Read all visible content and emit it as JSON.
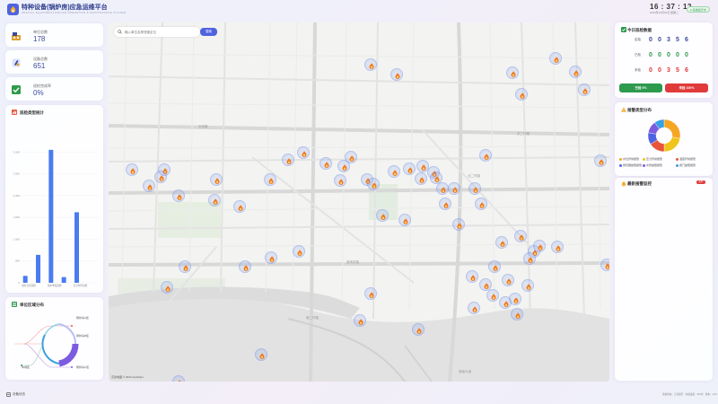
{
  "header": {
    "title": "特种设备(锅炉房)应急运维平台",
    "subtitle": "SPECIAL EQUIPMENT BOILER OPERATION & MAINTENANCE SYSTEM",
    "time": "16 : 37 : 12",
    "date": "2024年12月03日 星期二",
    "status": "● 系统运行中"
  },
  "stats": [
    {
      "label": "单位总数",
      "value": "178",
      "icon": "building-icon"
    },
    {
      "label": "设备总数",
      "value": "651",
      "icon": "equipment-icon"
    },
    {
      "label": "巡检完成率",
      "value": "0%",
      "icon": "check-icon"
    }
  ],
  "inspection_panel": {
    "title": "巡检类型统计"
  },
  "chart_data": {
    "type": "bar",
    "title": "",
    "categories": [
      "",
      "",
      "",
      "",
      "",
      ""
    ],
    "values": [
      160,
      640,
      3050,
      130,
      1620,
      0
    ],
    "ylim": [
      0,
      3500
    ],
    "yticks": [
      "0",
      "500",
      "1,000",
      "1,500",
      "2,000",
      "2,500",
      "3,000"
    ],
    "xticklabels": [
      "锅炉日常巡检",
      "",
      "锅炉季度巡检",
      "",
      "安全附件巡检",
      ""
    ]
  },
  "region_panel": {
    "title": "单位区域分布",
    "labels": [
      "锅炉房A区",
      "锅炉房B区",
      "锅炉房C区",
      "中城区"
    ]
  },
  "search": {
    "placeholder": "输入单位名称快速定位",
    "button": "搜索"
  },
  "map": {
    "road_labels": [
      "长安路",
      "宝鸡东路",
      "南二环路",
      "北二环路",
      "东二环路",
      "城南大道"
    ],
    "attribution": "高德地图 © 2024 AutoNavi"
  },
  "today_panel": {
    "title": "今日巡检数据",
    "rows": [
      {
        "label": "应检",
        "digits": [
          "0",
          "0",
          "3",
          "5",
          "6"
        ],
        "color": "#3a4a9c"
      },
      {
        "label": "已检",
        "digits": [
          "0",
          "0",
          "0",
          "0",
          "0"
        ],
        "color": "#2e9a4d"
      },
      {
        "label": "未检",
        "digits": [
          "0",
          "0",
          "3",
          "5",
          "6"
        ],
        "color": "#e03a3a"
      }
    ],
    "done_button": "已检 0%",
    "undone_button": "未检 100%"
  },
  "alarm_panel": {
    "title": "报警类型分布",
    "donut": [
      {
        "name": "水位异常报警",
        "value": 28,
        "color": "#f5a623"
      },
      {
        "name": "压力异常报警",
        "value": 22,
        "color": "#f0c419"
      },
      {
        "name": "温度异常报警",
        "value": 16,
        "color": "#e8553a"
      },
      {
        "name": "燃烧器故障报警",
        "value": 12,
        "color": "#4f63e0"
      },
      {
        "name": "水泵故障报警",
        "value": 12,
        "color": "#7b5be0"
      },
      {
        "name": "阀门故障报警",
        "value": 10,
        "color": "#3aa0e0"
      }
    ]
  },
  "latest_alarm_panel": {
    "title": "最新报警监控",
    "badge": "实时"
  },
  "footer": {
    "device_status": "设备状态",
    "status_text": "系统状态：正常运行 · 在线设备：651台 · 版本：V2.0"
  }
}
